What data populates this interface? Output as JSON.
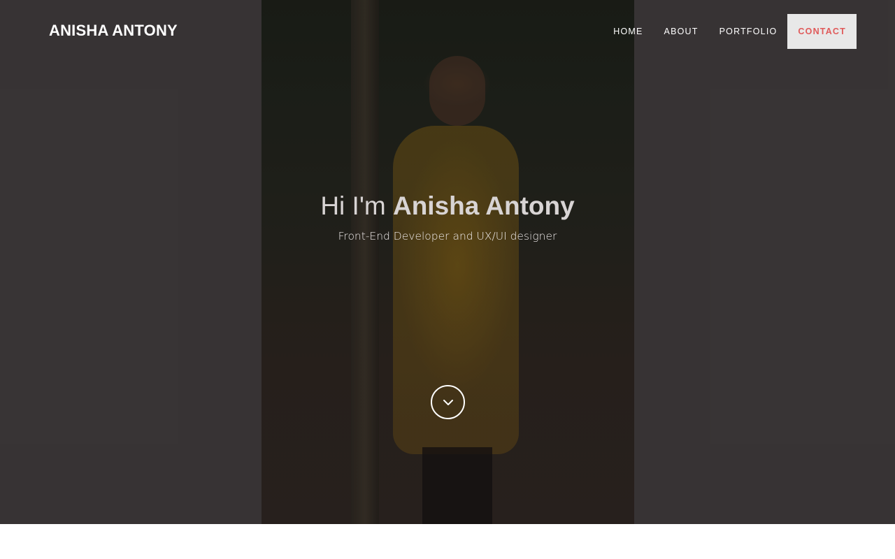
{
  "header": {
    "logo": "ANISHA ANTONY",
    "nav": [
      {
        "label": "HOME"
      },
      {
        "label": "ABOUT"
      },
      {
        "label": "PORTFOLIO"
      },
      {
        "label": "CONTACT",
        "active": true
      }
    ]
  },
  "hero": {
    "greeting": "Hi I'm",
    "name": "Anisha Antony",
    "subtitle": "Front-End Developer and UX/UI designer",
    "scroll_icon": "chevron-down-icon"
  },
  "colors": {
    "hero_background": "#3e3a3b",
    "active_nav_background": "#e8e8e8",
    "active_nav_text": "#e05a5a"
  }
}
